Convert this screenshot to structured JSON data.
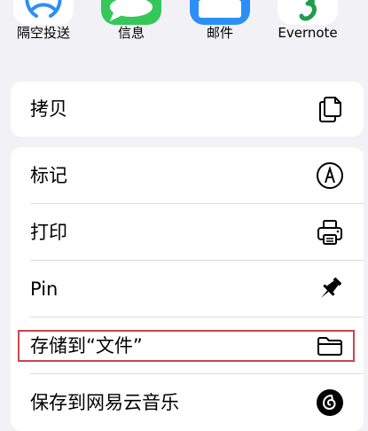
{
  "apps": [
    {
      "label": "隔空投送",
      "icon": "airdrop-icon"
    },
    {
      "label": "信息",
      "icon": "messages-icon"
    },
    {
      "label": "邮件",
      "icon": "mail-icon"
    },
    {
      "label": "Evernote",
      "icon": "evernote-icon"
    }
  ],
  "actions_group1": [
    {
      "label": "拷贝",
      "icon": "copy-icon"
    }
  ],
  "actions_group2": [
    {
      "label": "标记",
      "icon": "markup-icon"
    },
    {
      "label": "打印",
      "icon": "printer-icon"
    },
    {
      "label": "Pin",
      "icon": "pin-icon"
    },
    {
      "label": "存储到“文件”",
      "icon": "folder-icon"
    },
    {
      "label": "保存到网易云音乐",
      "icon": "netease-music-icon"
    }
  ],
  "colors": {
    "background": "#f2f2f6",
    "messages_green": "#35c759",
    "mail_blue": "#2c8ff5",
    "evernote_green": "#1f9e4a",
    "highlight_red": "#c8464e"
  }
}
